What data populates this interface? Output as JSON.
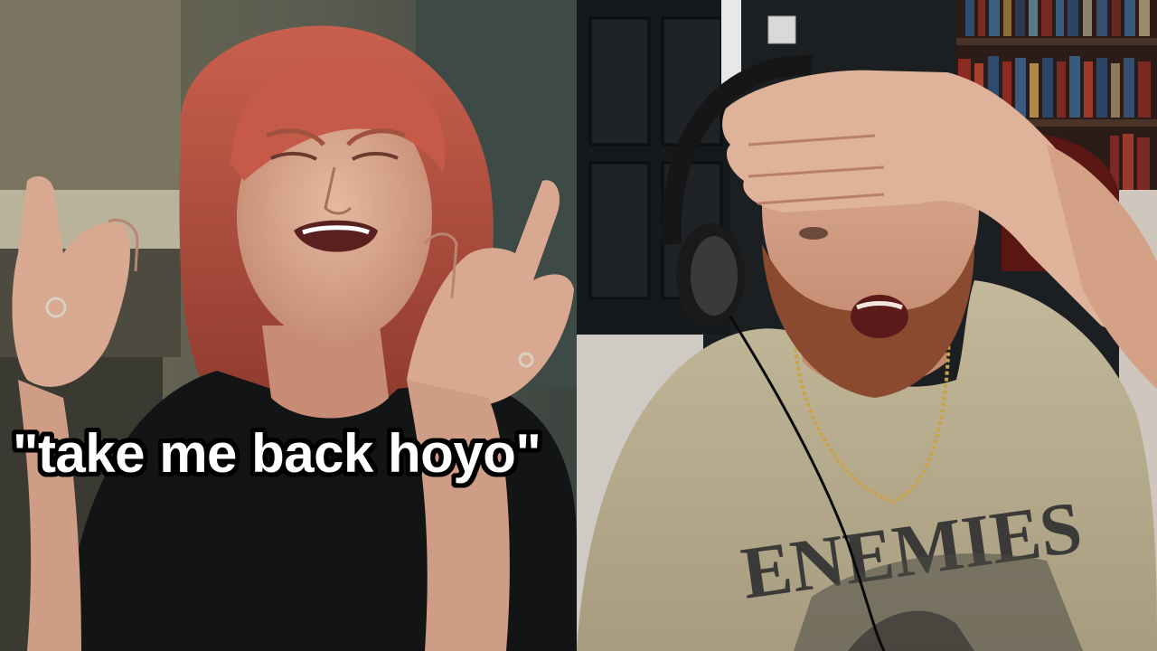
{
  "caption": "\"take me back hoyo\"",
  "shirt_print": "ENEMIES",
  "left_panel": {
    "description_icon": "crying-woman-photo"
  },
  "right_panel": {
    "description_icon": "reacting-man-with-headphones-photo"
  }
}
